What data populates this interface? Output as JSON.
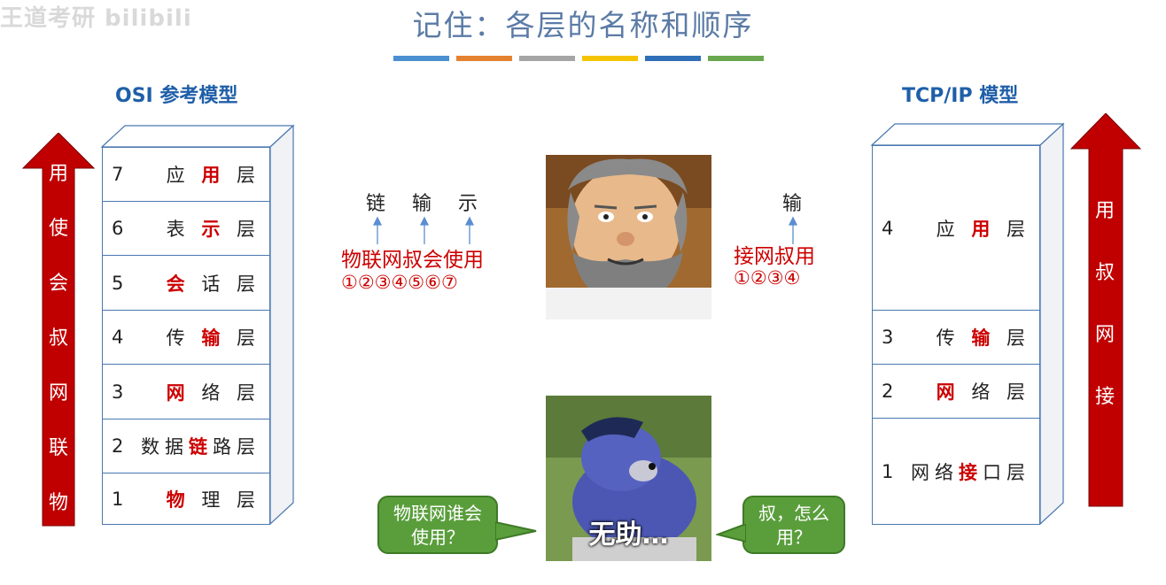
{
  "watermark": "王道考研 bilibili",
  "title": "记住：各层的名称和顺序",
  "title_bar_colors": [
    "#4a8fd0",
    "#e58230",
    "#a5a5a5",
    "#f5c400",
    "#2f6fb8",
    "#6aa84f"
  ],
  "osi": {
    "title": "OSI 参考模型",
    "arrow_chars": [
      "用",
      "使",
      "会",
      "叔",
      "网",
      "联",
      "物"
    ],
    "layers": [
      {
        "num": "7",
        "pre": "应 ",
        "hl": "用",
        "post": " 层"
      },
      {
        "num": "6",
        "pre": "表 ",
        "hl": "示",
        "post": " 层"
      },
      {
        "num": "5",
        "pre": "",
        "hl": "会",
        "post": " 话 层"
      },
      {
        "num": "4",
        "pre": "传 ",
        "hl": "输",
        "post": " 层"
      },
      {
        "num": "3",
        "pre": "",
        "hl": "网",
        "post": " 络 层"
      },
      {
        "num": "2",
        "pre": "数据",
        "hl": "链",
        "post": "路层"
      },
      {
        "num": "1",
        "pre": "",
        "hl": "物",
        "post": " 理 层"
      }
    ]
  },
  "tcpip": {
    "title": "TCP/IP 模型",
    "arrow_chars": [
      "用",
      "叔",
      "网",
      "接"
    ],
    "layers": [
      {
        "num": "4",
        "pre": "应 ",
        "hl": "用",
        "post": " 层"
      },
      {
        "num": "3",
        "pre": "传 ",
        "hl": "输",
        "post": " 层"
      },
      {
        "num": "2",
        "pre": "",
        "hl": "网",
        "post": " 络 层"
      },
      {
        "num": "1",
        "pre": "网络",
        "hl": "接",
        "post": "口层"
      }
    ]
  },
  "mnemonic_osi": {
    "notes": [
      "链",
      "输",
      "示"
    ],
    "phrase": "物联网叔会使用",
    "numbers": "①②③④⑤⑥⑦"
  },
  "mnemonic_tcp": {
    "note": "输",
    "phrase": "接网叔用",
    "numbers": "①②③④"
  },
  "meme": {
    "caption": "无助…",
    "bubble_left": "物联网谁会使用？",
    "bubble_right": "叔，怎么用？"
  }
}
